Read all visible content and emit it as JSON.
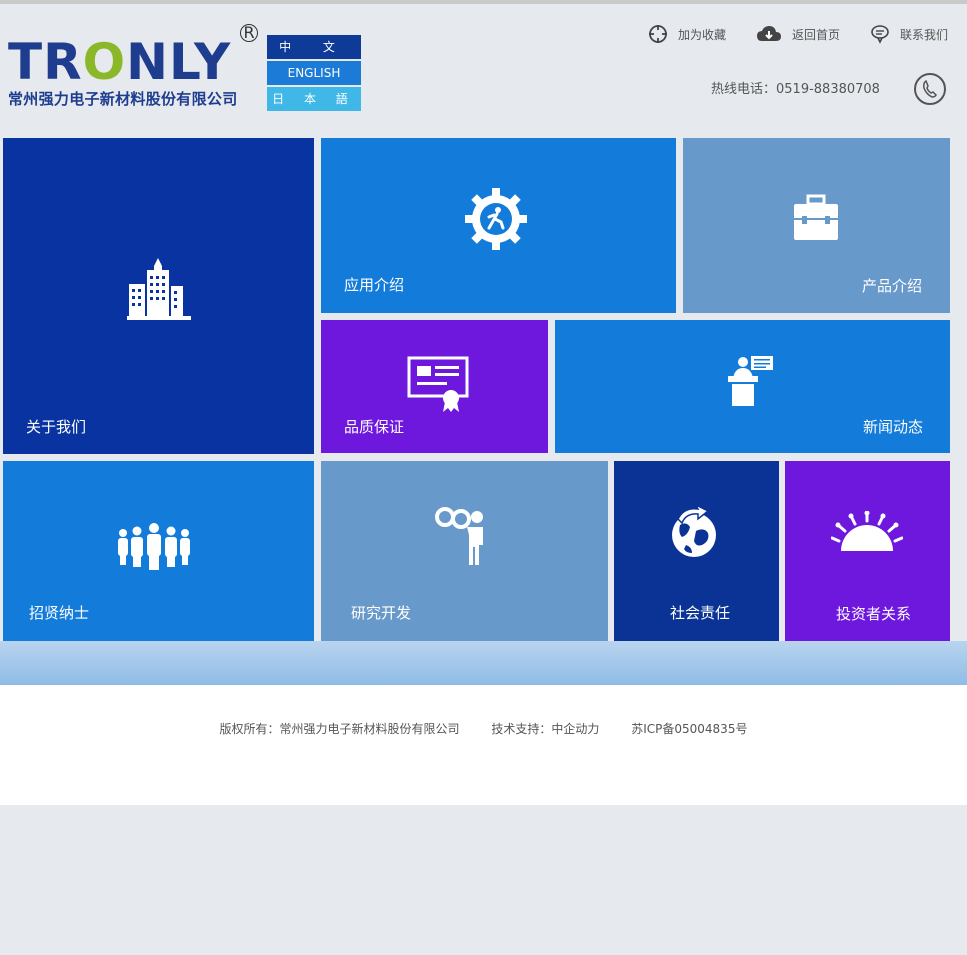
{
  "header": {
    "logo_text_a": "TR",
    "logo_text_o": "O",
    "logo_text_b": "NLY",
    "logo_reg": "R",
    "logo_subtitle": "常州强力电子新材料股份有限公司",
    "languages": [
      "中 文",
      "ENGLISH",
      "日 本 語"
    ],
    "links": {
      "favorite": "加为收藏",
      "home": "返回首页",
      "contact": "联系我们"
    },
    "hotline": "热线电话：0519-88380708"
  },
  "tiles": {
    "about": "关于我们",
    "application": "应用介绍",
    "products": "产品介绍",
    "quality": "品质保证",
    "news": "新闻动态",
    "recruit": "招贤纳士",
    "research": "研究开发",
    "social": "社会责任",
    "investor": "投资者关系"
  },
  "footer": {
    "copyright": "版权所有：常州强力电子新材料股份有限公司",
    "support": "技术支持：中企动力",
    "icp": "苏ICP备05004835号"
  },
  "colors": {
    "navy": "#0833a0",
    "blue": "#137bd9",
    "steel": "#6799cb",
    "purple": "#6e18de"
  }
}
